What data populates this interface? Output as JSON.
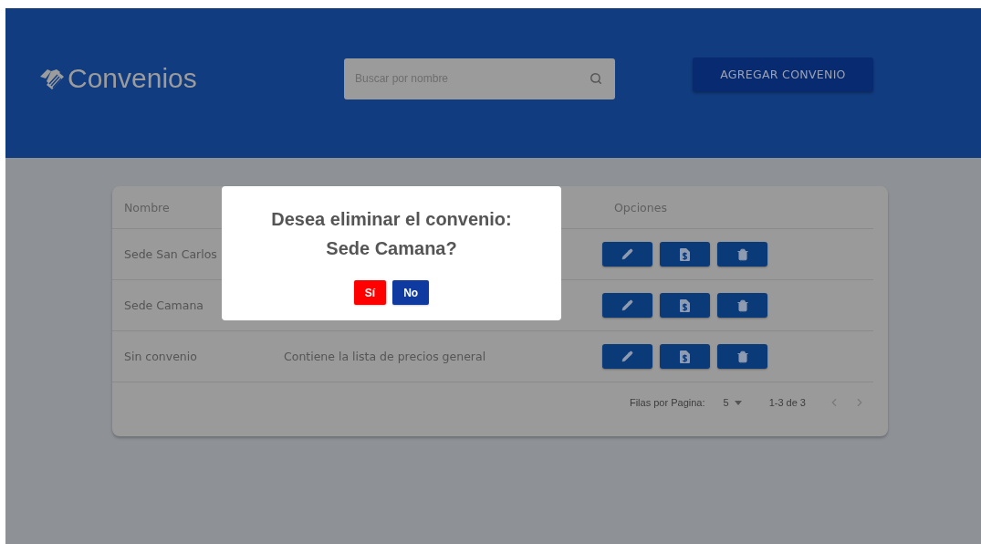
{
  "header": {
    "title": "Convenios",
    "search": {
      "placeholder": "Buscar por nombre"
    },
    "add_button": "AGREGAR CONVENIO"
  },
  "table": {
    "columns": [
      "Nombre",
      "Opciones"
    ],
    "rows": [
      {
        "name": "Sede San Carlos"
      },
      {
        "name": "Sede Camana"
      },
      {
        "name": "Sin convenio",
        "description": "Contiene la lista de precios general"
      }
    ],
    "footer": {
      "rows_label": "Filas por Pagina:",
      "rows_value": "5",
      "range": "1-3 de 3"
    }
  },
  "dialog": {
    "lines": [
      "Desea eliminar el convenio:",
      "Sede Camana?"
    ],
    "buttons": [
      {
        "label": "Sí",
        "kind": "confirm"
      },
      {
        "label": "No",
        "kind": "cancel"
      }
    ]
  }
}
